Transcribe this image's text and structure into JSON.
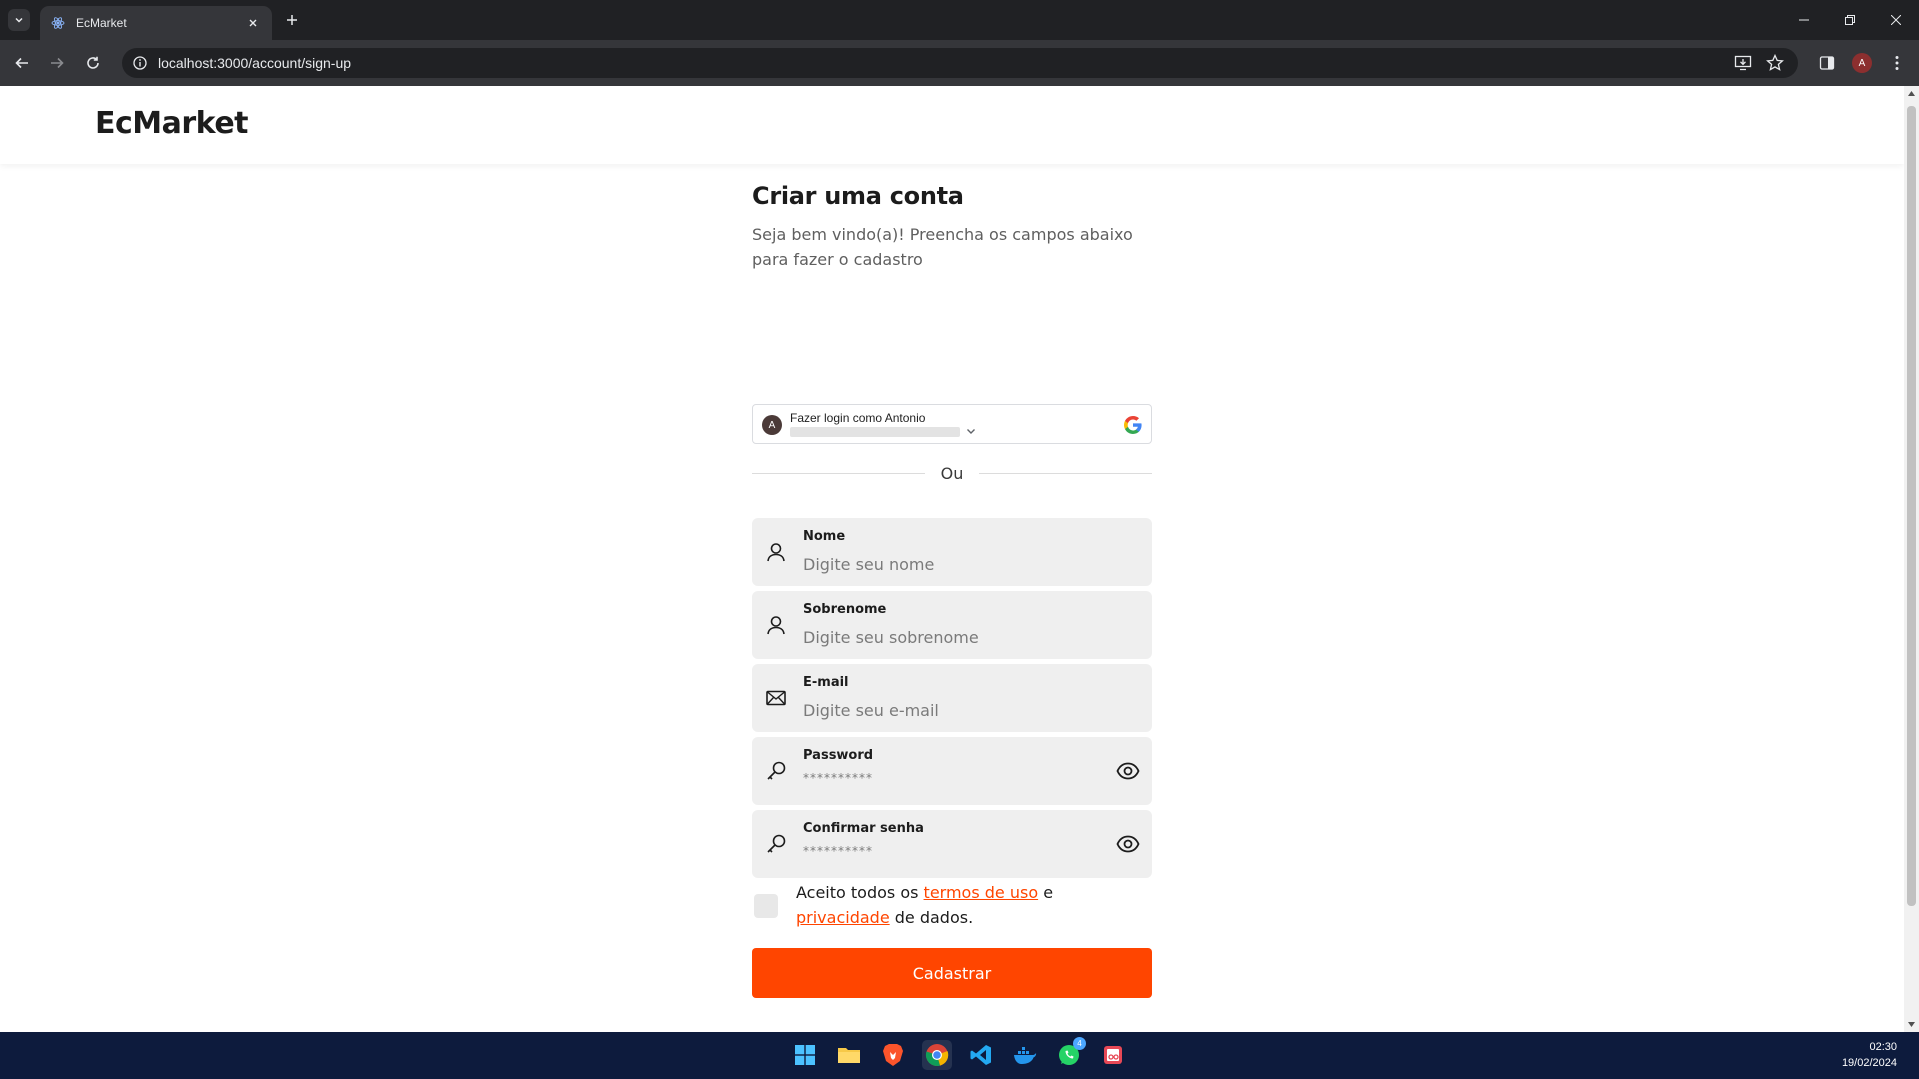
{
  "browser": {
    "tab_title": "EcMarket",
    "url": "localhost:3000/account/sign-up",
    "profile_initial": "A"
  },
  "site": {
    "logo": "EcMarket"
  },
  "form": {
    "title": "Criar uma conta",
    "subtitle": "Seja bem vindo(a)! Preencha os campos abaixo para fazer o cadastro",
    "google": {
      "avatar_initial": "A",
      "label": "Fazer login como Antonio"
    },
    "divider": "Ou",
    "fields": [
      {
        "label": "Nome",
        "placeholder": "Digite seu nome",
        "icon": "user-icon"
      },
      {
        "label": "Sobrenome",
        "placeholder": "Digite seu sobrenome",
        "icon": "user-icon"
      },
      {
        "label": "E-mail",
        "placeholder": "Digite seu e-mail",
        "icon": "mail-icon"
      },
      {
        "label": "Password",
        "masked": "**********",
        "icon": "key-icon"
      },
      {
        "label": "Confirmar senha",
        "masked": "**********",
        "icon": "key-icon"
      }
    ],
    "terms": {
      "prefix": "Aceito todos os ",
      "link1": "termos de uso",
      "middle": " e ",
      "link2": "privacidade",
      "suffix": " de dados."
    },
    "submit": "Cadastrar"
  },
  "taskbar": {
    "time": "02:30",
    "date": "19/02/2024",
    "whatsapp_badge": "4"
  },
  "colors": {
    "accent": "#ff4500",
    "field_bg": "#efefef"
  }
}
